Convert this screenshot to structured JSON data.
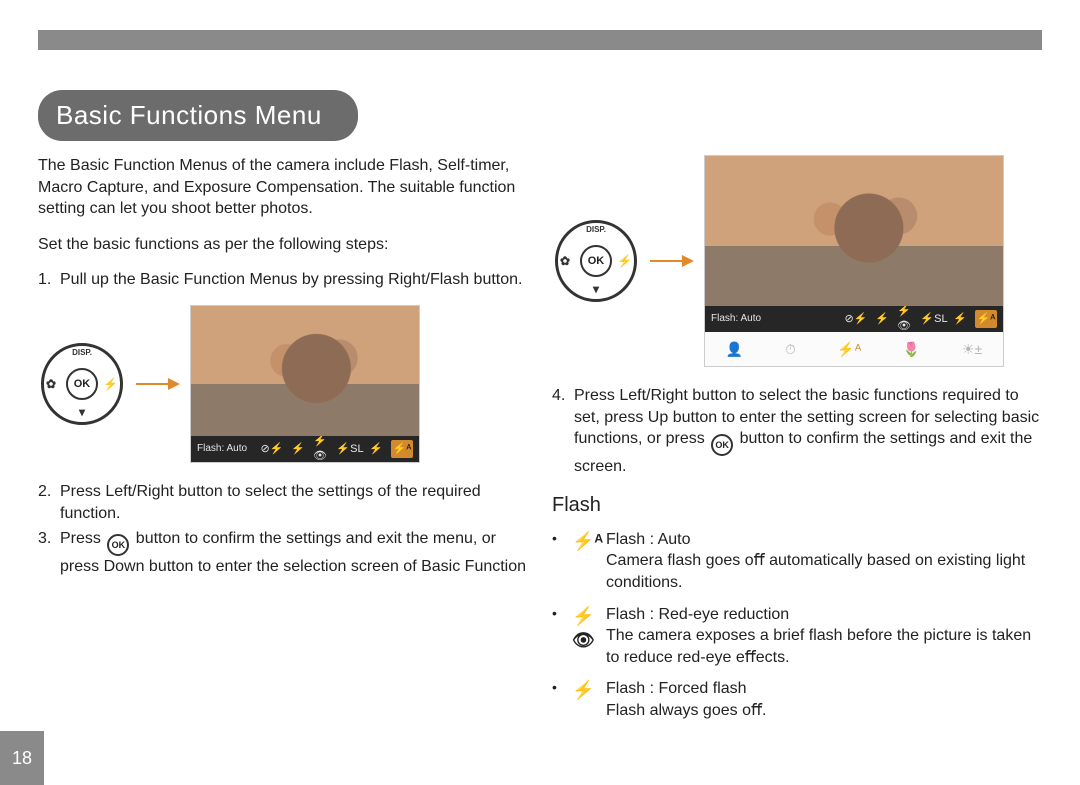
{
  "page_number": "18",
  "title": "Basic Functions Menu",
  "intro": "The Basic Function Menus of the camera include Flash, Self-timer, Macro Capture, and Exposure Compensation. The suitable function setting can let you shoot better photos.",
  "set_intro": "Set the basic functions as per the following steps:",
  "steps": {
    "s1_num": "1.",
    "s1": "Pull up the Basic Function Menus by pressing Right/Flash button.",
    "s2_num": "2.",
    "s2": "Press Left/Right button to select the settings of the required function.",
    "s3_num": "3.",
    "s3_a": "Press ",
    "s3_b": " button to conﬁrm the settings and exit the menu, or press Down button to enter the selection screen of Basic Function",
    "s4_num": "4.",
    "s4_a": "Press Left/Right button to select the basic functions required to set, press Up button to enter the setting screen for selecting basic functions, or press ",
    "s4_b": " button to conﬁrm the settings and exit the screen."
  },
  "dial": {
    "ok": "OK",
    "top": "DISP.",
    "bottom": "▾",
    "left": "✿",
    "right": "⚡"
  },
  "screenshot": {
    "label": "Flash: Auto",
    "icons": {
      "noflash": "⊘⚡",
      "auto": "⚡ᴬ",
      "red": "⚡👁",
      "slow": "⚡SL",
      "force": "⚡",
      "sel": "⚡ᴬ"
    }
  },
  "bottom_strip": {
    "i1": "👤",
    "i2": "⏱",
    "i3": "⚡ᴬ",
    "i4": "🌷",
    "i5": "☀±"
  },
  "flash_section": {
    "heading": "Flash",
    "bullet": "•",
    "items": [
      {
        "icon": "⚡ᴬ",
        "name": "Flash : Auto",
        "expl": "Camera ﬂash goes oﬀ automatically based on existing light conditions."
      },
      {
        "icon": "⚡👁",
        "name": "Flash : Red-eye reduction",
        "expl": "The camera exposes a brief ﬂash before the picture is taken to reduce red-eye eﬀects."
      },
      {
        "icon": "⚡",
        "name": "Flash : Forced ﬂash",
        "expl": "Flash always goes oﬀ."
      }
    ]
  }
}
